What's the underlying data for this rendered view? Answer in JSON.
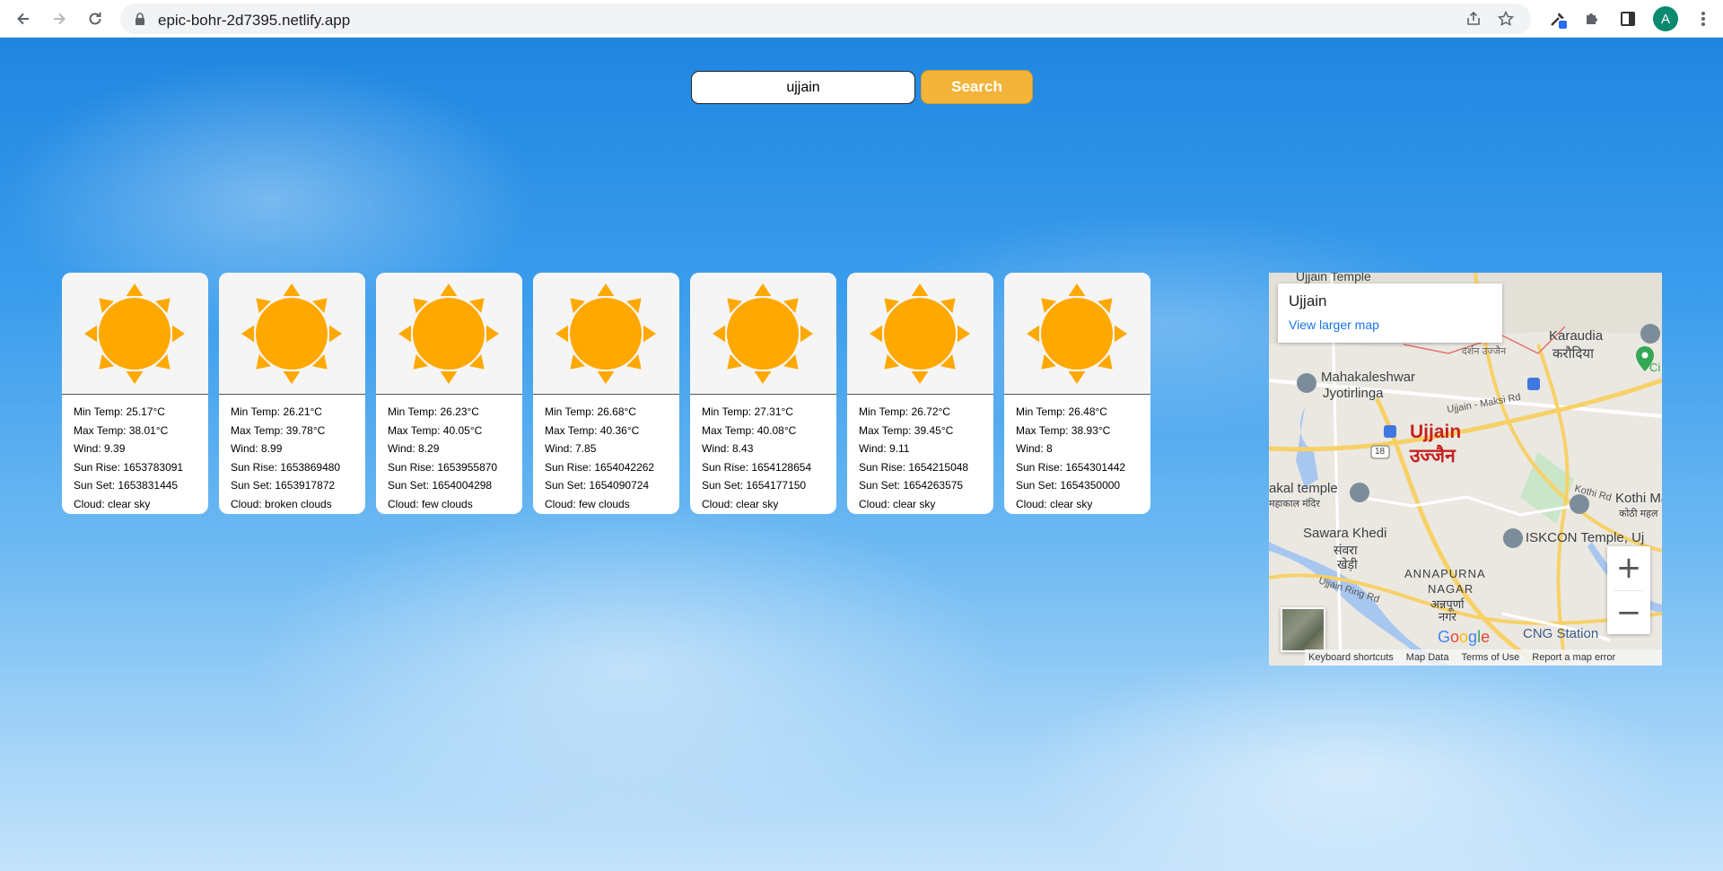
{
  "browser": {
    "url": "epic-bohr-2d7395.netlify.app",
    "avatar_letter": "A"
  },
  "search": {
    "value": "ujjain",
    "button_label": "Search"
  },
  "forecast": [
    {
      "min_temp": "Min Temp: 25.17°C",
      "max_temp": "Max Temp: 38.01°C",
      "wind": "Wind: 9.39",
      "sunrise": "Sun Rise: 1653783091",
      "sunset": "Sun Set: 1653831445",
      "cloud": "Cloud: clear sky",
      "icon": "sun-icon"
    },
    {
      "min_temp": "Min Temp: 26.21°C",
      "max_temp": "Max Temp: 39.78°C",
      "wind": "Wind: 8.99",
      "sunrise": "Sun Rise: 1653869480",
      "sunset": "Sun Set: 1653917872",
      "cloud": "Cloud: broken clouds",
      "icon": "sun-icon"
    },
    {
      "min_temp": "Min Temp: 26.23°C",
      "max_temp": "Max Temp: 40.05°C",
      "wind": "Wind: 8.29",
      "sunrise": "Sun Rise: 1653955870",
      "sunset": "Sun Set: 1654004298",
      "cloud": "Cloud: few clouds",
      "icon": "sun-icon"
    },
    {
      "min_temp": "Min Temp: 26.68°C",
      "max_temp": "Max Temp: 40.36°C",
      "wind": "Wind: 7.85",
      "sunrise": "Sun Rise: 1654042262",
      "sunset": "Sun Set: 1654090724",
      "cloud": "Cloud: few clouds",
      "icon": "sun-icon"
    },
    {
      "min_temp": "Min Temp: 27.31°C",
      "max_temp": "Max Temp: 40.08°C",
      "wind": "Wind: 8.43",
      "sunrise": "Sun Rise: 1654128654",
      "sunset": "Sun Set: 1654177150",
      "cloud": "Cloud: clear sky",
      "icon": "sun-icon"
    },
    {
      "min_temp": "Min Temp: 26.72°C",
      "max_temp": "Max Temp: 39.45°C",
      "wind": "Wind: 9.11",
      "sunrise": "Sun Rise: 1654215048",
      "sunset": "Sun Set: 1654263575",
      "cloud": "Cloud: clear sky",
      "icon": "sun-icon"
    },
    {
      "min_temp": "Min Temp: 26.48°C",
      "max_temp": "Max Temp: 38.93°C",
      "wind": "Wind: 8",
      "sunrise": "Sun Rise: 1654301442",
      "sunset": "Sun Set: 1654350000",
      "cloud": "Cloud: clear sky",
      "icon": "sun-icon"
    }
  ],
  "map": {
    "place_title": "Ujjain",
    "view_larger": "View larger map",
    "labels": {
      "ujjain_temple": "Ujjain Temple",
      "karaudia": "Karaudia",
      "karaudia_hi": "करौदिया",
      "darshan": "दर्शन उज्जैन",
      "mahakaleshwar": "Mahakaleshwar",
      "jyotirlinga": "Jyotirlinga",
      "ujjain_maksi": "Ujjain - Maksi Rd",
      "city": "Ujjain",
      "city_hi": "उज्जैन",
      "route18": "18",
      "akal_temple": "akal temple",
      "mahakal_hi": "महाकाल मंदिर",
      "kothi_rd": "Kothi Rd",
      "kothi_ma": "Kothi Ma",
      "kothi_hi": "कोठी महल",
      "sawara_khedi": "Sawara Khedi",
      "sawara_hi1": "संवरा",
      "sawara_hi2": "खेड़ी",
      "iskcon": "ISKCON Temple, Uj",
      "annapurna1": "ANNAPURNA",
      "annapurna2": "NAGAR",
      "annapurna_hi1": "अन्नपूर्णा",
      "annapurna_hi2": "नगर",
      "ring_rd": "Ujjain Ring Rd",
      "cng": "CNG Station",
      "green_label": "Ci"
    },
    "zoom_in": "+",
    "zoom_out": "−",
    "footer": {
      "shortcuts": "Keyboard shortcuts",
      "map_data": "Map Data",
      "terms": "Terms of Use",
      "report": "Report a map error"
    },
    "google_logo": [
      "G",
      "o",
      "o",
      "g",
      "l",
      "e"
    ]
  },
  "colors": {
    "sun": "#ffa800",
    "search_button": "#f4b43a",
    "map_link": "#1a73e8",
    "city_label": "#c5221f"
  }
}
